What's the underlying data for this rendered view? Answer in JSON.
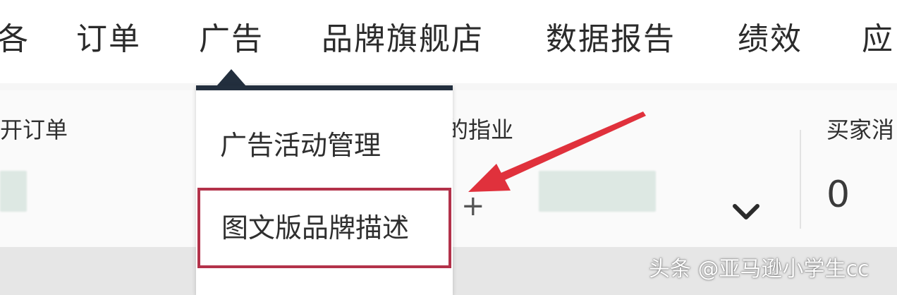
{
  "nav": {
    "items": [
      {
        "label": "各"
      },
      {
        "label": "订单"
      },
      {
        "label": "广告"
      },
      {
        "label": "品牌旗舰店"
      },
      {
        "label": "数据报告"
      },
      {
        "label": "绩效"
      },
      {
        "label": "应"
      }
    ],
    "active": "广告"
  },
  "ad_menu": {
    "items": [
      {
        "label": "广告活动管理"
      },
      {
        "label": "图文版品牌描述"
      }
    ],
    "highlighted": "图文版品牌描述"
  },
  "dashboard": {
    "cards": [
      {
        "label": "开订单"
      },
      {
        "label": "的指业"
      },
      {
        "label": "买家消",
        "value": "0"
      }
    ]
  },
  "annotation": {
    "arrow_color": "#e0313c",
    "highlight_color": "#b3324a"
  },
  "icons": {
    "dropdown": "chevron-down-icon"
  },
  "watermark": {
    "text": "头条 @亚马逊小学生cc"
  }
}
